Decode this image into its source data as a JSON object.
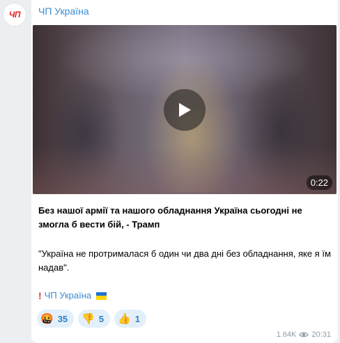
{
  "channel": {
    "avatar_text": "ЧП",
    "name": "ЧП Україна"
  },
  "video": {
    "duration": "0:22",
    "icon": "play-icon"
  },
  "post": {
    "headline": "Без нашої армії та нашого обладнання Україна сьогодні не змогла б вести бій, - Трамп",
    "quote": "\"Україна не протрималася б один чи два дні без обладнання, яке я їм надав\".",
    "signature": "ЧП Україна"
  },
  "reactions": [
    {
      "emoji": "🤬",
      "count": "35"
    },
    {
      "emoji": "👎",
      "count": "5"
    },
    {
      "emoji": "👍",
      "count": "1"
    }
  ],
  "meta": {
    "views": "1.64K",
    "time": "20:31"
  },
  "colors": {
    "accent": "#3a8bd1",
    "background": "#eceff1",
    "reaction_bg": "#e3f0fb"
  }
}
